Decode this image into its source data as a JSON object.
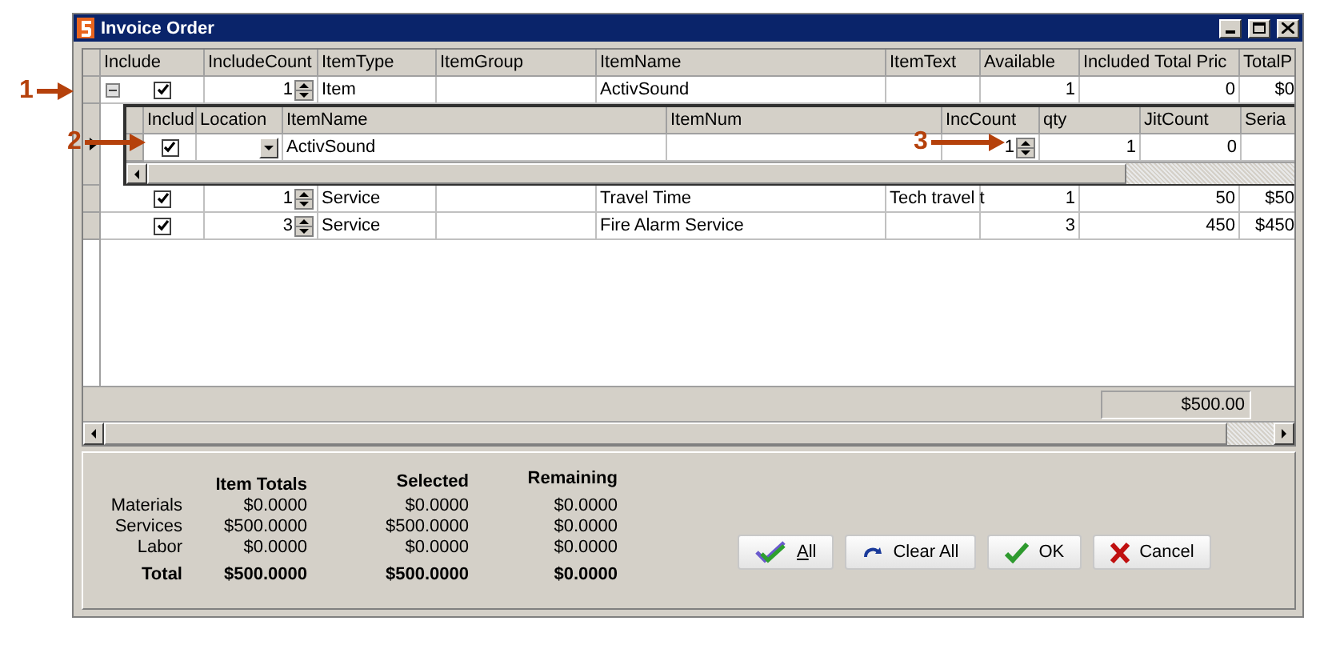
{
  "window": {
    "title": "Invoice Order"
  },
  "grid": {
    "columns": [
      "Include",
      "IncludeCount",
      "ItemType",
      "ItemGroup",
      "ItemName",
      "ItemText",
      "Available",
      "Included Total Pric",
      "TotalP"
    ],
    "rows": [
      {
        "expanded": true,
        "include": true,
        "include_count": "1",
        "item_type": "Item",
        "item_group": "",
        "item_name": "ActivSound",
        "item_text": "",
        "available": "1",
        "included_total_price": "0",
        "total_price": "$0",
        "detail": {
          "columns": [
            "Includ",
            "Location",
            "ItemName",
            "ItemNum",
            "IncCount",
            "qty",
            "JitCount",
            "Seria"
          ],
          "rows": [
            {
              "include": true,
              "location": "",
              "item_name": "ActivSound",
              "item_num": "",
              "inc_count": "1",
              "qty": "1",
              "jit_count": "0",
              "serial": ""
            }
          ]
        }
      },
      {
        "include": true,
        "include_count": "1",
        "item_type": "Service",
        "item_group": "",
        "item_name": "Travel Time",
        "item_text": "Tech travel t",
        "available": "1",
        "included_total_price": "50",
        "total_price": "$50"
      },
      {
        "include": true,
        "include_count": "3",
        "item_type": "Service",
        "item_group": "",
        "item_name": "Fire Alarm Service",
        "item_text": "",
        "available": "3",
        "included_total_price": "450",
        "total_price": "$450"
      }
    ],
    "footer_total": "$500.00"
  },
  "summary": {
    "columns": [
      "Item Totals",
      "Selected",
      "Remaining"
    ],
    "rows": [
      {
        "label": "Materials",
        "values": [
          "$0.0000",
          "$0.0000",
          "$0.0000"
        ],
        "bold": false
      },
      {
        "label": "Services",
        "values": [
          "$500.0000",
          "$500.0000",
          "$0.0000"
        ],
        "bold": false
      },
      {
        "label": "Labor",
        "values": [
          "$0.0000",
          "$0.0000",
          "$0.0000"
        ],
        "bold": false
      },
      {
        "label": "Total",
        "values": [
          "$500.0000",
          "$500.0000",
          "$0.0000"
        ],
        "bold": true
      }
    ]
  },
  "buttons": [
    {
      "kind": "all",
      "label": "All",
      "mnemonic": true
    },
    {
      "kind": "clear",
      "label": "Clear All",
      "mnemonic": false
    },
    {
      "kind": "ok",
      "label": "OK",
      "mnemonic": false
    },
    {
      "kind": "cancel",
      "label": "Cancel",
      "mnemonic": false
    }
  ],
  "callouts": [
    "1",
    "2",
    "3"
  ]
}
